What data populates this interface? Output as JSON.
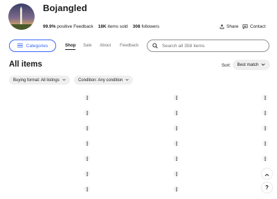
{
  "seller": {
    "name": "Bojangled",
    "feedback_percent": "99.9%",
    "feedback_label": "positive Feedback",
    "items_sold_count": "18K",
    "items_sold_label": "items sold",
    "followers_count": "308",
    "followers_label": "followers"
  },
  "header_actions": {
    "share_label": "Share",
    "contact_label": "Contact"
  },
  "nav": {
    "categories_label": "Categories",
    "tabs": [
      {
        "label": "Shop",
        "active": true
      },
      {
        "label": "Sale",
        "active": false
      },
      {
        "label": "About",
        "active": false
      },
      {
        "label": "Feedback",
        "active": false
      }
    ]
  },
  "search": {
    "placeholder": "Search all 358 items"
  },
  "listing": {
    "title": "All items",
    "sort_label": "Sort:",
    "sort_value": "Best match",
    "filters": [
      {
        "label": "Buying format: All listings"
      },
      {
        "label": "Condition: Any condition"
      }
    ]
  },
  "icons": {
    "categories": "hamburger-icon",
    "search": "search-icon",
    "share": "share-icon",
    "contact": "message-icon",
    "more": "more-vertical-icon",
    "scroll_top": "chevron-up-icon",
    "help": "help-icon"
  },
  "colors": {
    "accent": "#3665f3",
    "text": "#191919",
    "muted": "#707070",
    "pill_bg": "#efefef"
  }
}
